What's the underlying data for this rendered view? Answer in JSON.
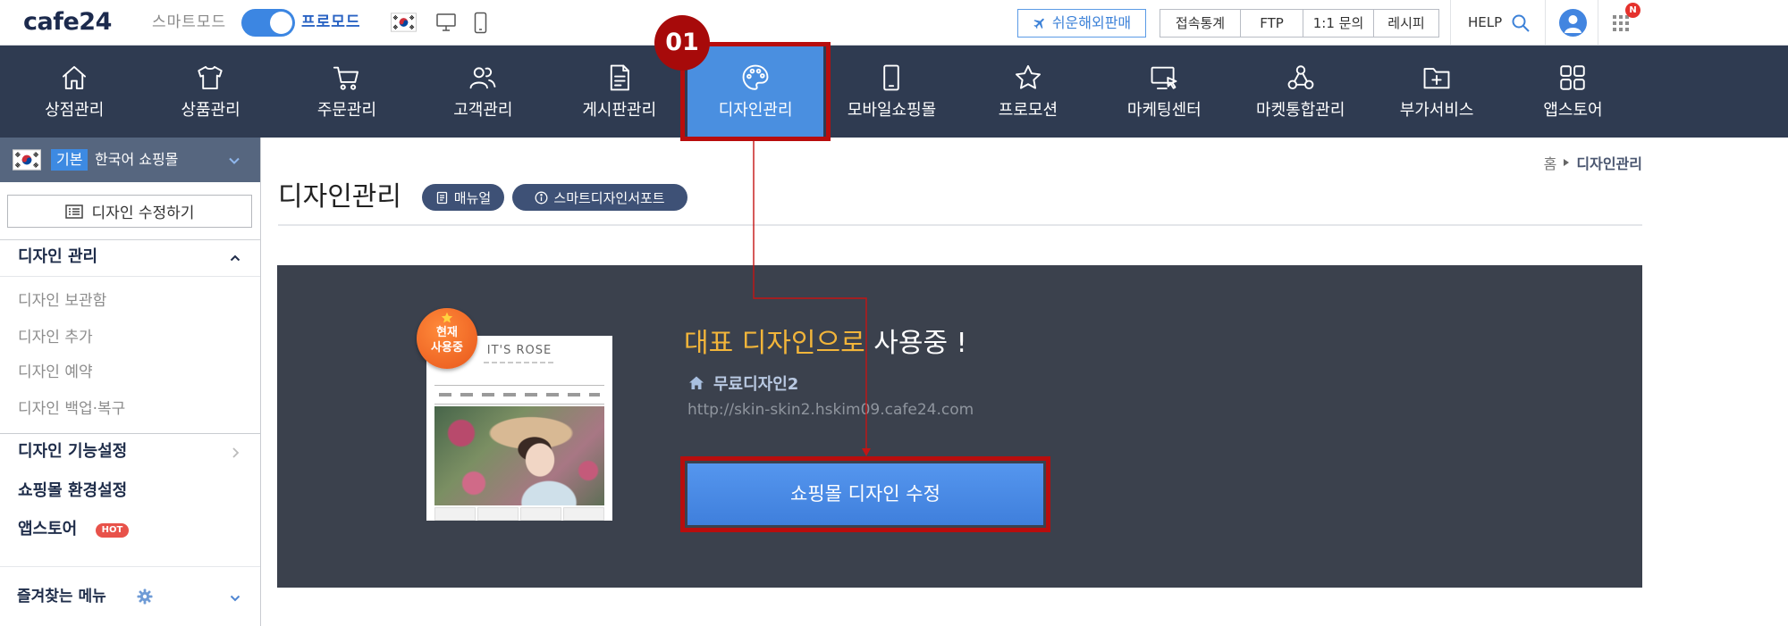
{
  "topbar": {
    "logo": "cafe24",
    "mode_smart": "스마트모드",
    "mode_pro": "프로모드",
    "global_sell": "쉬운해외판매",
    "links": [
      "접속통계",
      "FTP",
      "1:1 문의",
      "레시피"
    ],
    "help": "HELP",
    "apps_badge": "N"
  },
  "nav": {
    "active_index": 5,
    "items": [
      {
        "label": "상점관리",
        "icon": "home-icon"
      },
      {
        "label": "상품관리",
        "icon": "shirt-icon"
      },
      {
        "label": "주문관리",
        "icon": "cart-icon"
      },
      {
        "label": "고객관리",
        "icon": "users-icon"
      },
      {
        "label": "게시판관리",
        "icon": "board-icon"
      },
      {
        "label": "디자인관리",
        "icon": "palette-icon"
      },
      {
        "label": "모바일쇼핑몰",
        "icon": "mobile-icon"
      },
      {
        "label": "프로모션",
        "icon": "star-icon"
      },
      {
        "label": "마케팅센터",
        "icon": "monitor-cursor-icon"
      },
      {
        "label": "마켓통합관리",
        "icon": "network-icon"
      },
      {
        "label": "부가서비스",
        "icon": "folder-plus-icon"
      },
      {
        "label": "앱스토어",
        "icon": "apps-grid-icon"
      }
    ]
  },
  "annotation": {
    "step_label": "01"
  },
  "sidebar": {
    "shop_badge": "기본",
    "shop_name": "한국어 쇼핑몰",
    "edit_design": "디자인 수정하기",
    "section": {
      "title": "디자인 관리",
      "expanded": true,
      "items": [
        "디자인 보관함",
        "디자인 추가",
        "디자인 예약",
        "디자인 백업·복구"
      ]
    },
    "menu": [
      {
        "label": "디자인 기능설정"
      },
      {
        "label": "쇼핑몰 환경설정"
      },
      {
        "label": "앱스토어",
        "badge": "HOT"
      }
    ],
    "favorites": "즐겨찾는 메뉴"
  },
  "page": {
    "breadcrumb": [
      "홈",
      "디자인관리"
    ],
    "title": "디자인관리",
    "manual_button": "매뉴얼",
    "support_button": "스마트디자인서포트"
  },
  "design_panel": {
    "status_badge": [
      "현재",
      "사용중"
    ],
    "headline_highlight": "대표 디자인으로",
    "headline_rest": "사용중 !",
    "design_name": "무료디자인2",
    "design_url": "http://skin-skin2.hskim09.cafe24.com",
    "edit_button": "쇼핑몰 디자인 수정",
    "thumbnail": {
      "brand": "IT'S ROSE"
    }
  },
  "colors": {
    "nav_bg": "#2f3b51",
    "accent": "#4a8fe0",
    "panel_bg": "#3b414d",
    "headline_highlight": "#f2b53a",
    "annotation_red": "#b80d0d",
    "hot_badge": "#e8524a"
  }
}
